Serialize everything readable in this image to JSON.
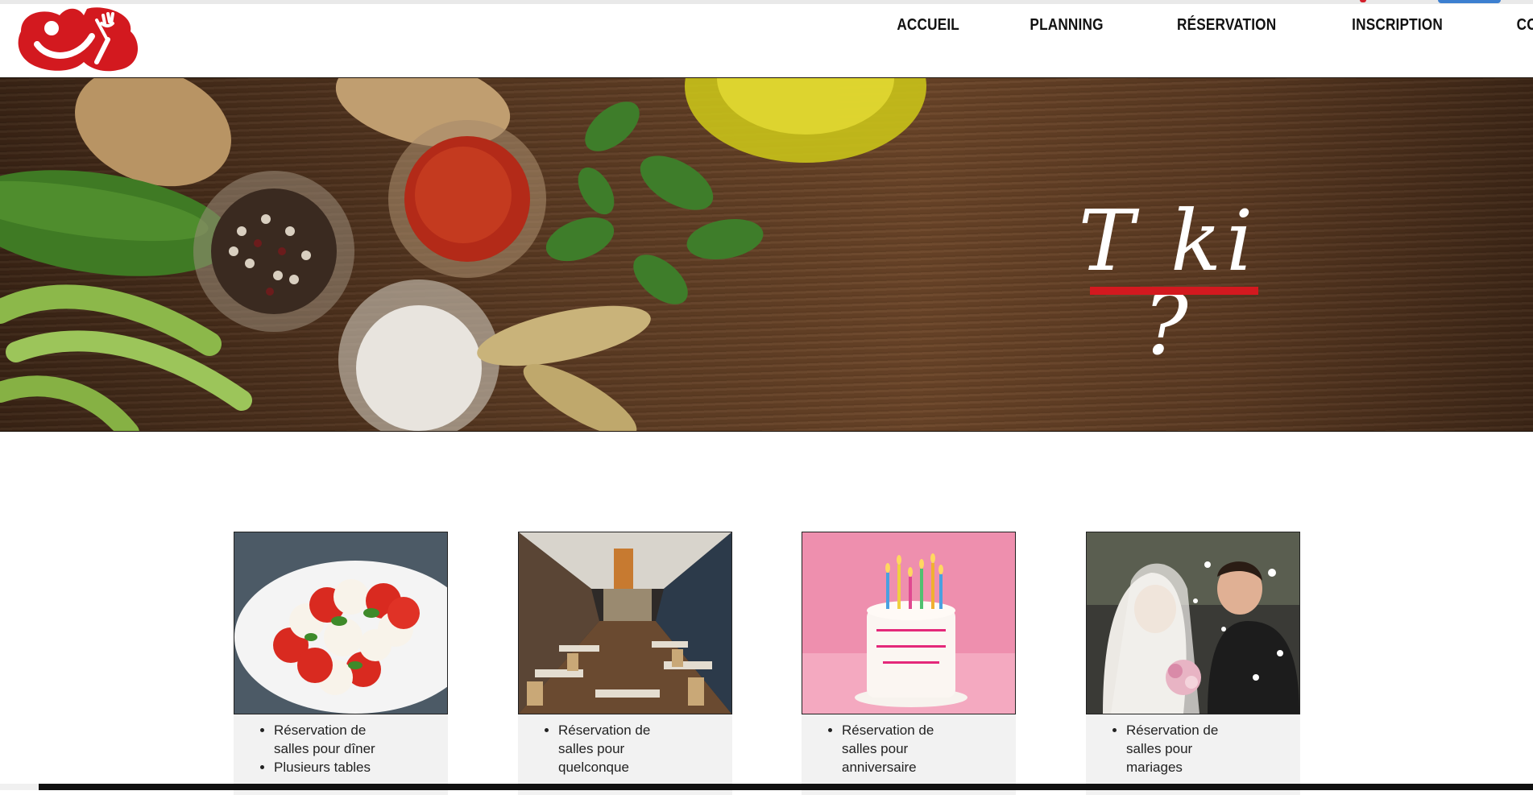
{
  "nav": {
    "items": [
      "ACCUEIL",
      "PLANNING",
      "RÉSERVATION",
      "INSCRIPTION",
      "CONNEXION"
    ]
  },
  "hero": {
    "title": "T ki ?"
  },
  "cards": [
    {
      "image": "caprese-salad",
      "bullets": [
        "Réservation de salles pour dîner",
        "Plusieurs tables"
      ]
    },
    {
      "image": "restaurant-hall",
      "bullets": [
        "Réservation de salles pour quelconque"
      ]
    },
    {
      "image": "birthday-cake",
      "bullets": [
        "Réservation de salles pour anniversaire"
      ]
    },
    {
      "image": "wedding-couple",
      "bullets": [
        "Réservation de salles pour mariages"
      ]
    }
  ],
  "colors": {
    "brand_red": "#d3191f",
    "nav_text": "#111111"
  }
}
